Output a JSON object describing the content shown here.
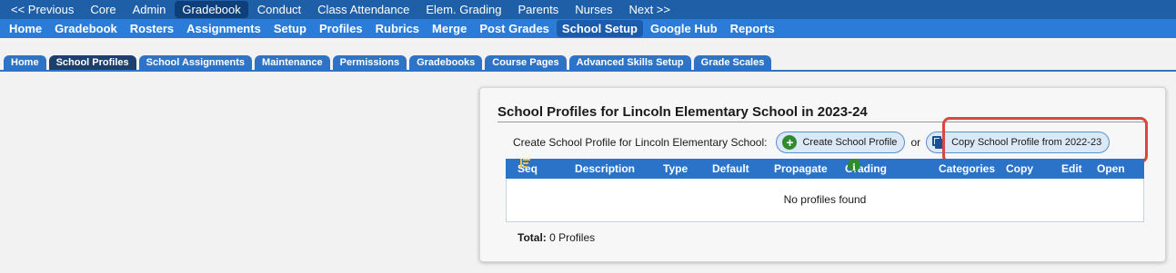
{
  "primary_nav": [
    "<< Previous",
    "Core",
    "Admin",
    "Gradebook",
    "Conduct",
    "Class Attendance",
    "Elem. Grading",
    "Parents",
    "Nurses",
    "Next >>"
  ],
  "secondary_nav": [
    "Home",
    "Gradebook",
    "Rosters",
    "Assignments",
    "Setup",
    "Profiles",
    "Rubrics",
    "Merge",
    "Post Grades",
    "School Setup",
    "Google Hub",
    "Reports"
  ],
  "tabs": [
    "Home",
    "School Profiles",
    "School Assignments",
    "Maintenance",
    "Permissions",
    "Gradebooks",
    "Course Pages",
    "Advanced Skills Setup",
    "Grade Scales"
  ],
  "card": {
    "title": "School Profiles for Lincoln Elementary School in 2023-24",
    "create_label": "Create School Profile for Lincoln Elementary School:",
    "create_button": "Create School Profile",
    "or_text": "or",
    "copy_button": "Copy School Profile from 2022-23"
  },
  "table": {
    "columns": [
      "Seq",
      "Description",
      "Type",
      "Default",
      "Propagate",
      "Grading",
      "Categories",
      "Copy",
      "Edit",
      "Open"
    ],
    "empty_message": "No profiles found",
    "total_label": "Total:",
    "total_value": "0 Profiles"
  },
  "colors": {
    "primary_nav_bg": "#1f5fa8",
    "secondary_nav_bg": "#2b7bd8",
    "tab_bg": "#2f73c7",
    "tab_active_bg": "#1c3f6c",
    "table_header_bg": "#2b72c9",
    "highlight_border": "#d9473e"
  },
  "icons": {
    "sort": "sort-icon",
    "info": "info-icon",
    "create": "plus-circle-icon",
    "copy": "copy-icon"
  }
}
